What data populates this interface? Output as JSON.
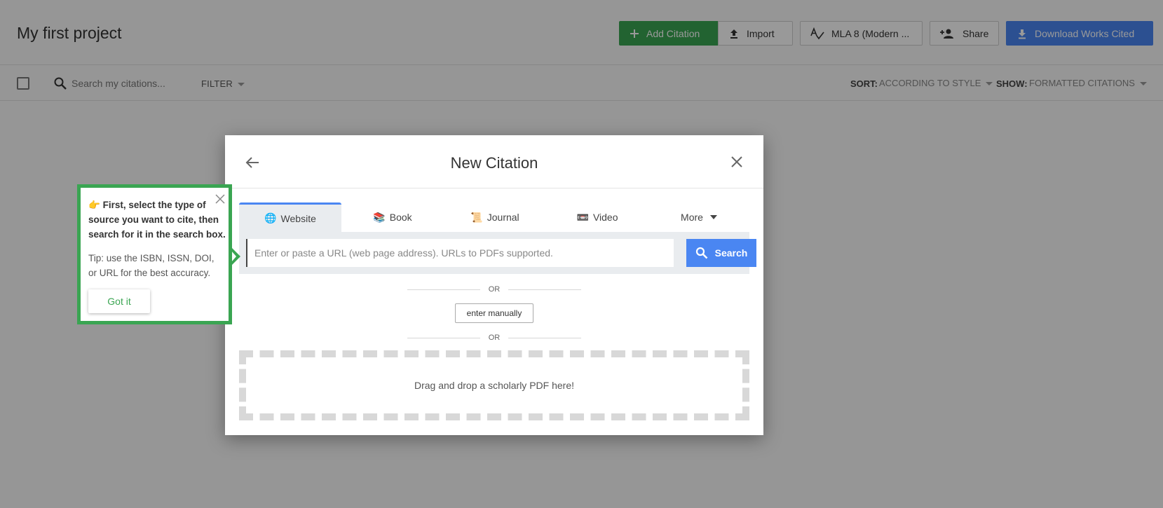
{
  "header": {
    "project_title": "My first project",
    "add_citation": "Add Citation",
    "import": "Import",
    "style": "MLA 8 (Modern ...",
    "share": "Share",
    "download": "Download Works Cited"
  },
  "toolbar": {
    "search_placeholder": "Search my citations...",
    "filter": "FILTER",
    "sort_label": "SORT:",
    "sort_value": "ACCORDING TO STYLE",
    "show_label": "SHOW:",
    "show_value": "FORMATTED CITATIONS"
  },
  "modal": {
    "title": "New Citation",
    "tabs": [
      {
        "label": "Website",
        "icon": "🌐"
      },
      {
        "label": "Book",
        "icon": "📚"
      },
      {
        "label": "Journal",
        "icon": "📜"
      },
      {
        "label": "Video",
        "icon": "📼"
      },
      {
        "label": "More"
      }
    ],
    "url_placeholder": "Enter or paste a URL (web page address). URLs to PDFs supported.",
    "search_button": "Search",
    "or_text": "OR",
    "manual_button": "enter manually",
    "dropzone_text": "Drag and drop a scholarly PDF here!"
  },
  "tip": {
    "icon": "👉",
    "text1": "First, select the type of source you want to cite, then search for it in the search box.",
    "text2": "Tip: use the ISBN, ISSN, DOI, or URL for the best accuracy.",
    "button": "Got it"
  },
  "colors": {
    "green": "#3aa552",
    "blue": "#4a86f2"
  }
}
